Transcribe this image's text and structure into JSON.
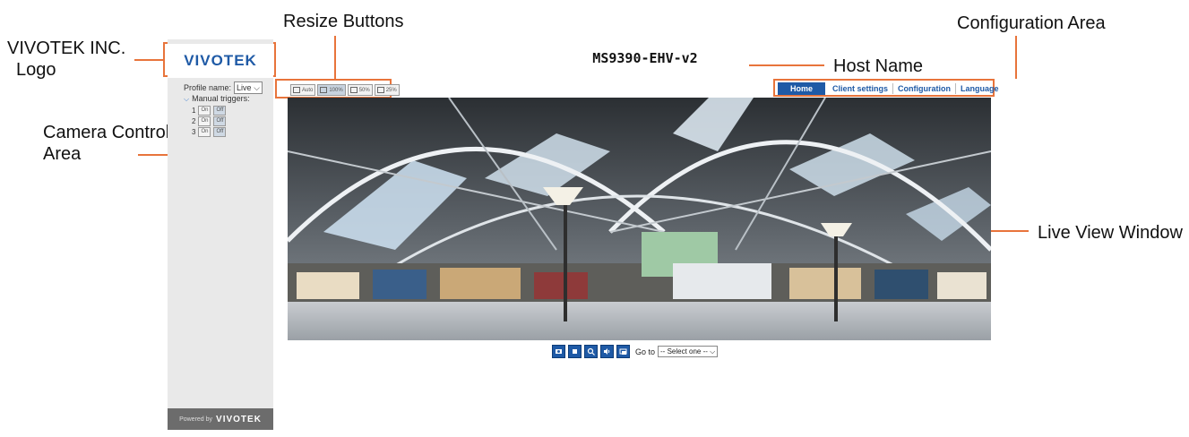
{
  "annotations": {
    "logo": [
      "VIVOTEK INC.",
      "Logo"
    ],
    "resize": "Resize Buttons",
    "camera_control": [
      "Camera Control",
      "Area"
    ],
    "configuration": "Configuration Area",
    "host_name": "Host Name",
    "live_view": "Live View Window"
  },
  "sidebar": {
    "logo": "VIVOTEK",
    "profile_label": "Profile name:",
    "profile_value": "Live",
    "triggers_label": "Manual triggers:",
    "triggers": [
      {
        "index": "1",
        "on": "On",
        "off": "Off"
      },
      {
        "index": "2",
        "on": "On",
        "off": "Off"
      },
      {
        "index": "3",
        "on": "On",
        "off": "Off"
      }
    ],
    "powered_by": "Powered by",
    "powered_brand": "VIVOTEK"
  },
  "header": {
    "host_name": "MS9390-EHV-v2"
  },
  "nav": [
    {
      "label": "Home",
      "active": true
    },
    {
      "label": "Client settings"
    },
    {
      "label": "Configuration"
    },
    {
      "label": "Language"
    }
  ],
  "resize_buttons": [
    {
      "label": "Auto"
    },
    {
      "label": "100%",
      "selected": true
    },
    {
      "label": "50%"
    },
    {
      "label": "25%"
    }
  ],
  "toolbar": {
    "buttons": [
      "snapshot-icon",
      "stop-icon",
      "digital-zoom-icon",
      "volume-icon",
      "fullscreen-icon"
    ],
    "goto_label": "Go to",
    "goto_value": "-- Select one --"
  },
  "colors": {
    "accent": "#1f5aa6",
    "annotation": "#e8743b",
    "sidebar": "#e9e9e9"
  }
}
